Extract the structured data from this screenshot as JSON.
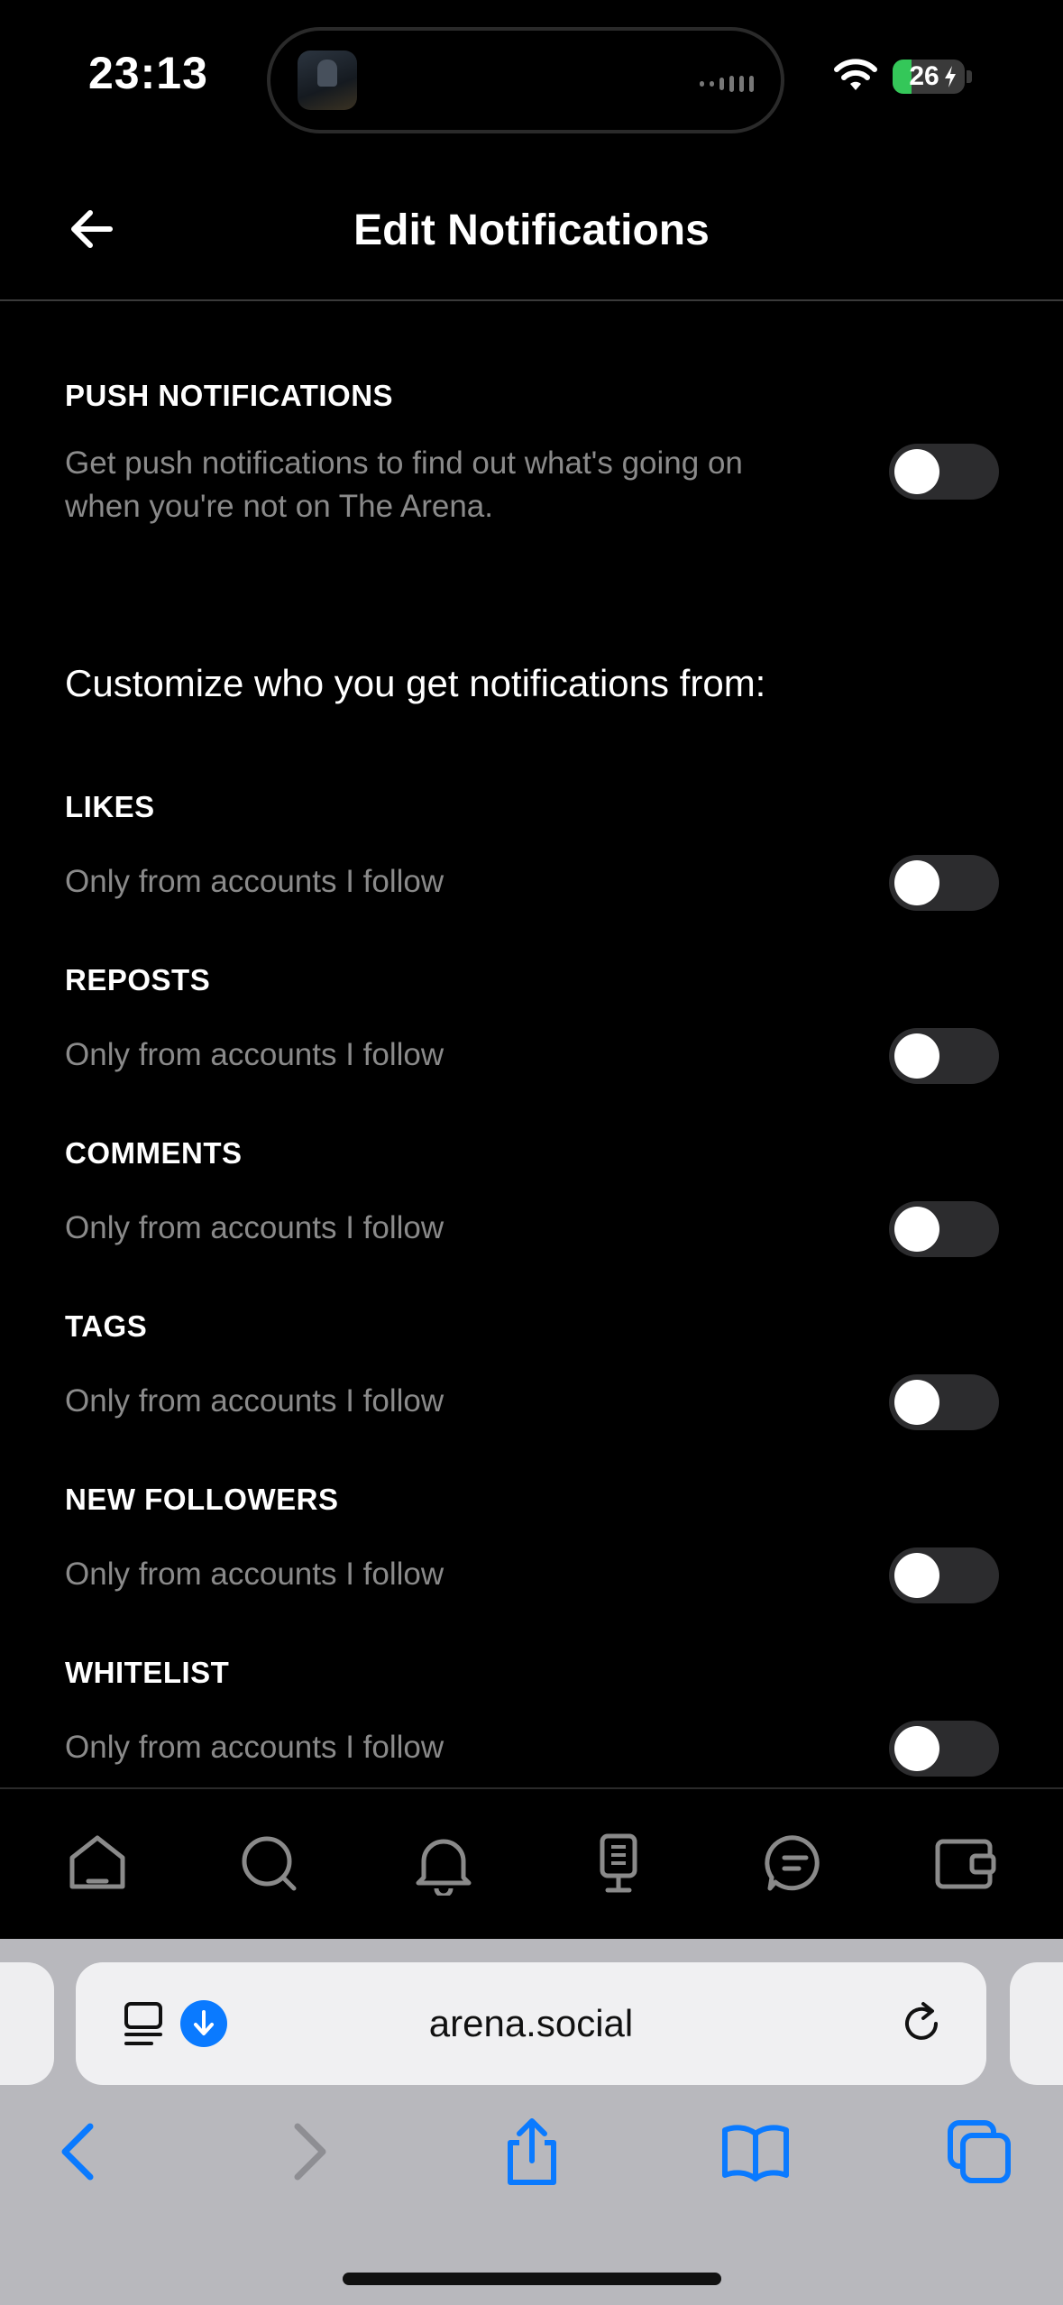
{
  "status_bar": {
    "time": "23:13",
    "battery": "26"
  },
  "header": {
    "title": "Edit Notifications"
  },
  "push": {
    "label": "PUSH NOTIFICATIONS",
    "description_line1": "Get push notifications to find out what's going on",
    "description_line2": "when you're not on The Arena.",
    "enabled": false
  },
  "customize_heading": "Customize who you get notifications from:",
  "categories": [
    {
      "label": "LIKES",
      "description": "Only from accounts I follow",
      "enabled": false
    },
    {
      "label": "REPOSTS",
      "description": "Only from accounts I follow",
      "enabled": false
    },
    {
      "label": "COMMENTS",
      "description": "Only from accounts I follow",
      "enabled": false
    },
    {
      "label": "TAGS",
      "description": "Only from accounts I follow",
      "enabled": false
    },
    {
      "label": "NEW FOLLOWERS",
      "description": "Only from accounts I follow",
      "enabled": false
    },
    {
      "label": "WHITELIST",
      "description": "Only from accounts I follow",
      "enabled": false
    }
  ],
  "bottom_nav": {
    "items": [
      "home-icon",
      "search-icon",
      "bell-icon",
      "podium-icon",
      "chat-icon",
      "wallet-icon"
    ]
  },
  "browser": {
    "url": "arena.social"
  },
  "colors": {
    "background": "#000000",
    "muted_text": "#8a8a8a",
    "toggle_off": "#2c2c2e",
    "safari_blue": "#0a7aff"
  }
}
